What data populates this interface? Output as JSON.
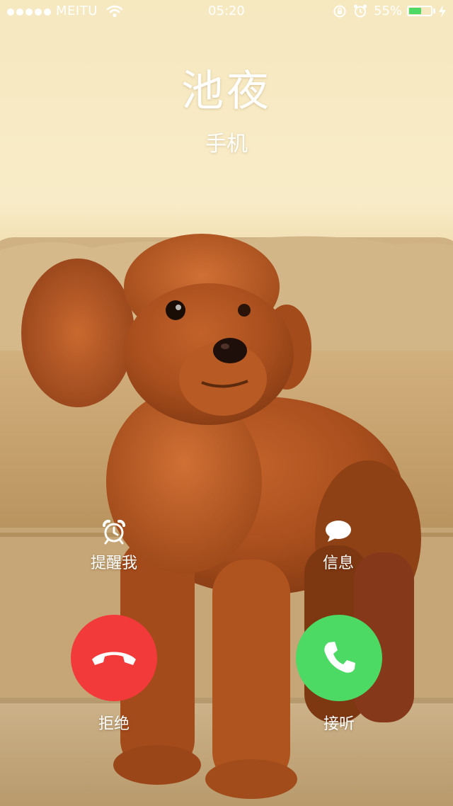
{
  "status_bar": {
    "carrier": "MEITU",
    "time": "05:20",
    "battery_percent": "55%",
    "battery_level": 0.55,
    "signal_bars": 5
  },
  "caller": {
    "name": "池夜",
    "label": "手机"
  },
  "actions": {
    "remind_label": "提醒我",
    "message_label": "信息"
  },
  "buttons": {
    "decline_label": "拒绝",
    "accept_label": "接听"
  },
  "colors": {
    "decline": "#f23a3a",
    "accept": "#4cd964",
    "battery": "#4cd964"
  },
  "icons": {
    "remind": "alarm-clock-icon",
    "message": "speech-bubble-icon",
    "decline": "hang-up-phone-icon",
    "accept": "phone-icon"
  }
}
